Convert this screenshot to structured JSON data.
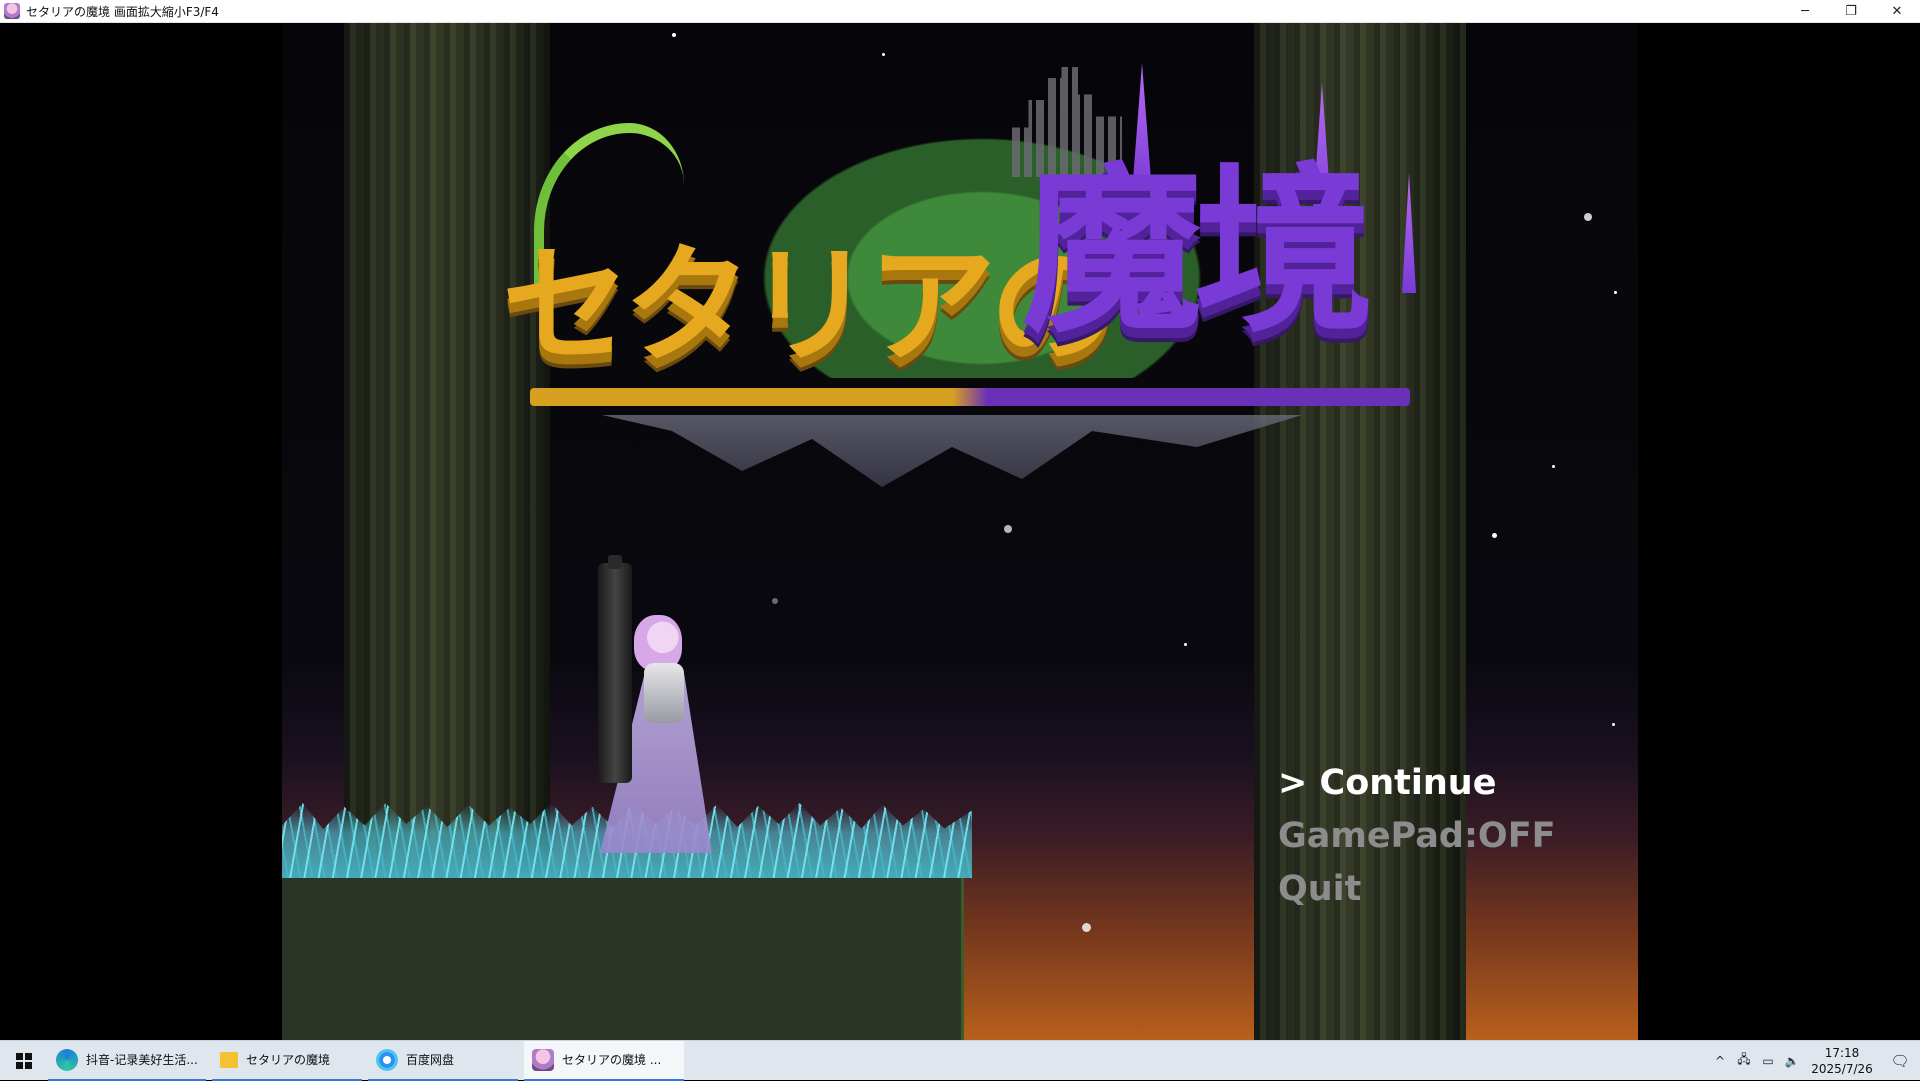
{
  "window": {
    "title": "セタリアの魔境  画面拡大縮小F3/F4",
    "controls": {
      "minimize": "─",
      "restore": "❐",
      "close": "✕"
    }
  },
  "game": {
    "logo": {
      "kana": "セタリアの",
      "kanji": "魔境",
      "colors": {
        "kana": "#e6a81e",
        "kanji": "#7a3ad6"
      }
    },
    "menu": {
      "items": [
        {
          "label": "> Continue",
          "selected": true
        },
        {
          "label": "GamePad:OFF",
          "selected": false
        },
        {
          "label": "Quit",
          "selected": false
        }
      ]
    }
  },
  "taskbar": {
    "items": [
      {
        "label": "抖音-记录美好生活...",
        "icon": "edge-icon"
      },
      {
        "label": "セタリアの魔境",
        "icon": "folder-icon"
      },
      {
        "label": "百度网盘",
        "icon": "baidu-netdisk-icon"
      },
      {
        "label": "セタリアの魔境  ...",
        "icon": "game-icon",
        "active": true
      }
    ],
    "tray": {
      "chevron": "^",
      "network": "🖧",
      "battery": "▭",
      "volume": "🔈"
    },
    "clock": {
      "time": "17:18",
      "date": "2025/7/26"
    },
    "notification": "🗨"
  }
}
